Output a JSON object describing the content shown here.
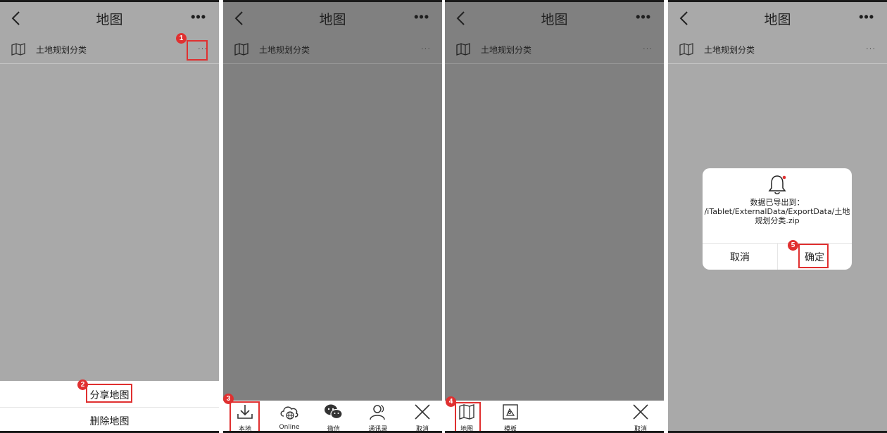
{
  "header": {
    "title": "地图",
    "more": "•••"
  },
  "map_item": {
    "label": "土地规划分类",
    "more": "···"
  },
  "sheet": {
    "share_label": "分享地图",
    "delete_label": "删除地图"
  },
  "share_targets": [
    {
      "label": "本地",
      "icon": "download-icon"
    },
    {
      "label": "Online",
      "icon": "cloud-globe-icon"
    },
    {
      "label": "微信",
      "icon": "wechat-icon"
    },
    {
      "label": "通讯录",
      "icon": "contacts-icon"
    },
    {
      "label": "取消",
      "icon": "close-icon"
    }
  ],
  "share_type": {
    "map_label": "地图",
    "template_label": "模板",
    "cancel_label": "取消"
  },
  "dialog": {
    "line1": "数据已导出到：",
    "line2": "/iTablet/ExternalData/ExportData/土地",
    "line3": "规划分类.zip",
    "cancel_label": "取消",
    "confirm_label": "确定"
  },
  "steps": [
    "1",
    "2",
    "3",
    "4",
    "5"
  ],
  "colors": {
    "highlight": "#e03030",
    "dim_overlay": "#808080",
    "light_overlay": "#a9a9a9"
  }
}
